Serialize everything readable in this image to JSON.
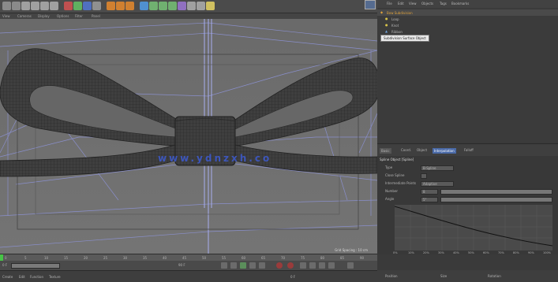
{
  "toolbar": {
    "icons": [
      "undo-icon",
      "redo-icon",
      "select-icon",
      "move-icon",
      "scale-icon",
      "rotate-icon",
      "axis-x-icon",
      "axis-y-icon",
      "axis-z-icon",
      "world-icon",
      "render-view-icon",
      "render-icon",
      "render-settings-icon",
      "cube-icon",
      "pen-icon",
      "subdivide-icon",
      "array-icon",
      "deformer-icon",
      "floor-icon",
      "camera-icon",
      "light-icon"
    ]
  },
  "viewport": {
    "menu": [
      "View",
      "Cameras",
      "Display",
      "Options",
      "Filter",
      "Panel"
    ],
    "watermark": "www.ydnzxh.co",
    "status": "Grid Spacing : 10 cm"
  },
  "object_manager": {
    "menu": [
      "File",
      "Edit",
      "View",
      "Objects",
      "Tags",
      "Bookmarks"
    ],
    "objects": [
      {
        "name": "Bow Subdivision"
      },
      {
        "name": "Loop"
      },
      {
        "name": "Knot"
      },
      {
        "name": "Ribbon"
      }
    ],
    "tooltip": "Subdivision Surface Object"
  },
  "attributes": {
    "tabs": [
      "Basic",
      "Coord.",
      "Object",
      "Interpolation",
      "Falloff"
    ],
    "header": "Spline Object [Spline]",
    "fields": [
      {
        "label": "Type",
        "value": "B-Spline"
      },
      {
        "label": "Close Spline",
        "value": ""
      },
      {
        "label": "Intermediate Points",
        "value": "Adaptive"
      },
      {
        "label": "Number",
        "value": "8"
      },
      {
        "label": "Angle",
        "value": "5°"
      }
    ],
    "graph_x_labels": [
      "0%",
      "10%",
      "20%",
      "30%",
      "40%",
      "50%",
      "60%",
      "70%",
      "80%",
      "90%",
      "100%"
    ]
  },
  "timeline": {
    "ticks": [
      "0",
      "5",
      "10",
      "15",
      "20",
      "25",
      "30",
      "35",
      "40",
      "45",
      "50",
      "55",
      "60",
      "65",
      "70",
      "75",
      "80",
      "85",
      "90"
    ],
    "start_frame": "0 F",
    "end_frame": "90 F"
  },
  "statusbar": {
    "menu": [
      "Create",
      "Edit",
      "Function",
      "Texture"
    ],
    "frame": "0 F"
  },
  "bottom_tabs": [
    "Position",
    "Size",
    "Rotation"
  ]
}
